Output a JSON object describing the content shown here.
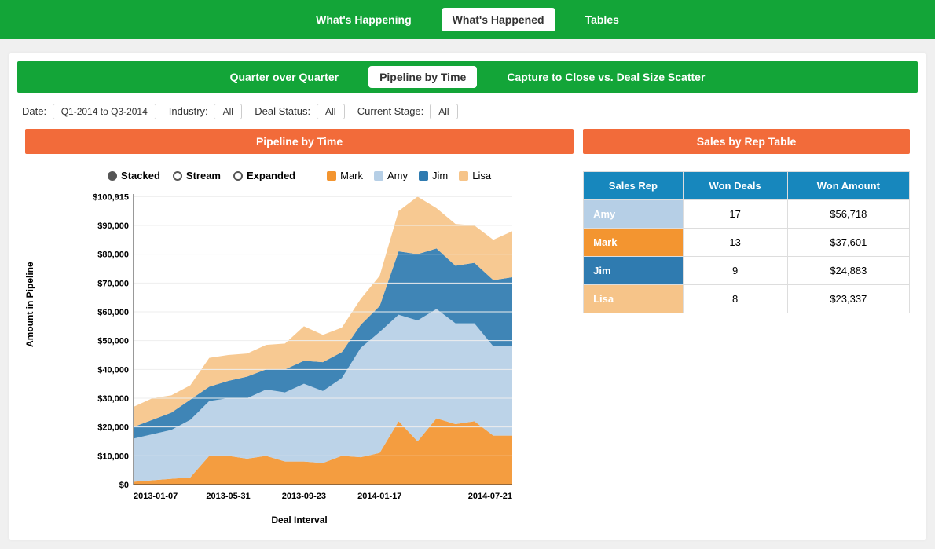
{
  "topnav": {
    "items": [
      {
        "label": "What's Happening",
        "active": false
      },
      {
        "label": "What's Happened",
        "active": true
      },
      {
        "label": "Tables",
        "active": false
      }
    ]
  },
  "subnav": {
    "items": [
      {
        "label": "Quarter over Quarter",
        "active": false
      },
      {
        "label": "Pipeline by Time",
        "active": true
      },
      {
        "label": "Capture to Close vs. Deal Size Scatter",
        "active": false
      }
    ]
  },
  "filters": {
    "date": {
      "label": "Date:",
      "value": "Q1-2014 to Q3-2014"
    },
    "industry": {
      "label": "Industry:",
      "value": "All"
    },
    "deal_status": {
      "label": "Deal Status:",
      "value": "All"
    },
    "current_stage": {
      "label": "Current Stage:",
      "value": "All"
    }
  },
  "panels": {
    "left_title": "Pipeline by Time",
    "right_title": "Sales by Rep Table"
  },
  "chart_toggles": [
    {
      "label": "Stacked",
      "selected": true
    },
    {
      "label": "Stream",
      "selected": false
    },
    {
      "label": "Expanded",
      "selected": false
    }
  ],
  "chart_data": {
    "type": "area",
    "title": "",
    "xlabel": "Deal Interval",
    "ylabel": "Amount in Pipeline",
    "ymax_label": "$100,915",
    "ylim": [
      0,
      100915
    ],
    "y_ticks": [
      "$0",
      "$10,000",
      "$20,000",
      "$30,000",
      "$40,000",
      "$50,000",
      "$60,000",
      "$70,000",
      "$80,000",
      "$90,000",
      "$100,915"
    ],
    "x_ticks": [
      "2013-01-07",
      "2013-05-31",
      "2013-09-23",
      "2014-01-17",
      "2014-07-21"
    ],
    "x_tick_pos": [
      0,
      0.25,
      0.45,
      0.65,
      1.0
    ],
    "series": [
      {
        "name": "Mark",
        "color": "#f39530",
        "values": [
          1000,
          1500,
          2000,
          2500,
          10000,
          10000,
          9000,
          10000,
          8000,
          8000,
          7500,
          10000,
          9500,
          11000,
          22000,
          15000,
          23000,
          21000,
          22000,
          17000,
          17000
        ]
      },
      {
        "name": "Amy",
        "color": "#b6cfe6",
        "values": [
          15000,
          16000,
          17000,
          20000,
          19000,
          20000,
          21000,
          23000,
          24000,
          27000,
          25000,
          27000,
          38000,
          42000,
          37000,
          42000,
          38000,
          35000,
          34000,
          31000,
          31000
        ]
      },
      {
        "name": "Jim",
        "color": "#2f7bb0",
        "values": [
          4000,
          5000,
          6000,
          7000,
          5000,
          6000,
          7500,
          7000,
          8000,
          8000,
          10000,
          9000,
          8000,
          9000,
          22000,
          23000,
          21000,
          20000,
          21000,
          23000,
          24000
        ]
      },
      {
        "name": "Lisa",
        "color": "#f6c489",
        "values": [
          7000,
          7500,
          6000,
          5000,
          10000,
          9000,
          8000,
          8500,
          9000,
          12000,
          9500,
          8500,
          9000,
          10500,
          14000,
          20000,
          14000,
          14500,
          13000,
          14000,
          16000
        ]
      }
    ]
  },
  "sales_table": {
    "headers": [
      "Sales Rep",
      "Won Deals",
      "Won Amount"
    ],
    "rows": [
      {
        "name": "Amy",
        "color": "#b6cfe6",
        "deals": "17",
        "amount": "$56,718"
      },
      {
        "name": "Mark",
        "color": "#f39530",
        "deals": "13",
        "amount": "$37,601"
      },
      {
        "name": "Jim",
        "color": "#2f7bb0",
        "deals": "9",
        "amount": "$24,883"
      },
      {
        "name": "Lisa",
        "color": "#f6c489",
        "deals": "8",
        "amount": "$23,337"
      }
    ]
  }
}
